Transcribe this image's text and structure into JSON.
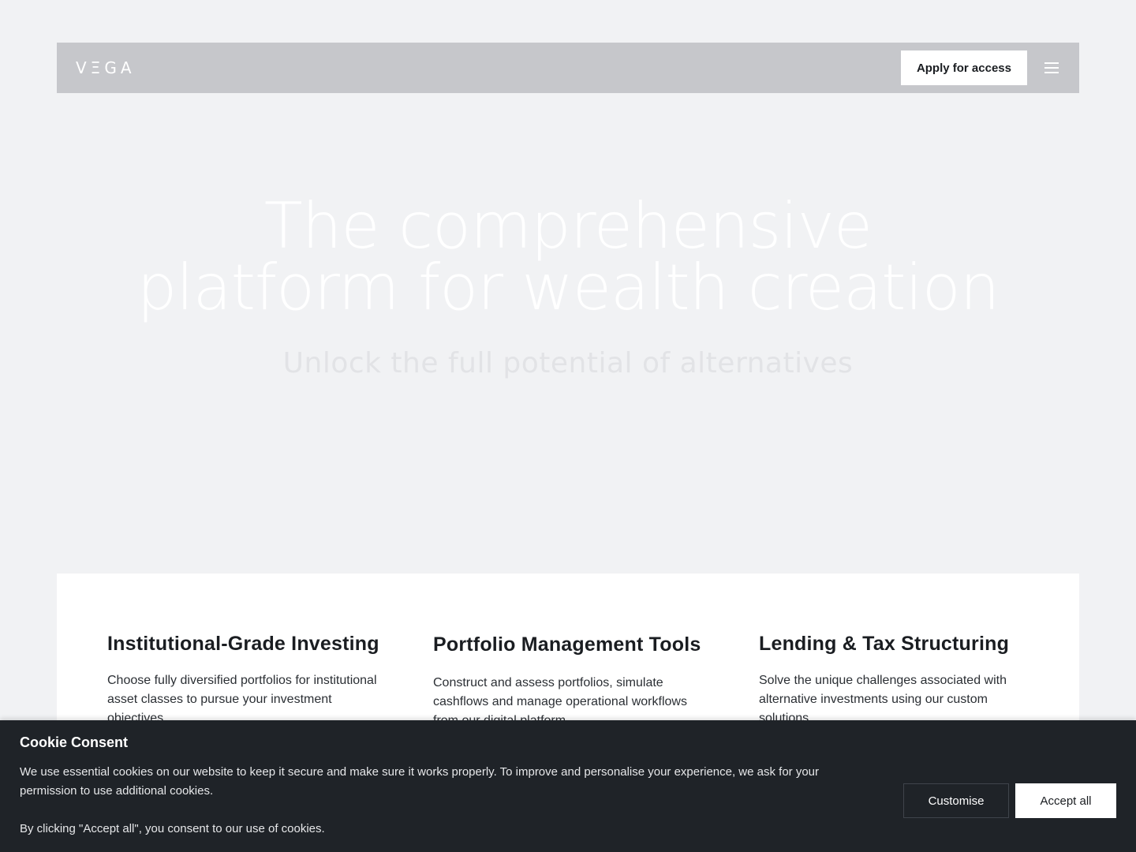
{
  "header": {
    "logo": "VΞGA",
    "apply_label": "Apply for access",
    "menu_icon": "hamburger-menu-icon"
  },
  "hero": {
    "title_line1": "The comprehensive",
    "title_line2": "platform for wealth creation",
    "subtitle": "Unlock the full potential of alternatives"
  },
  "features": [
    {
      "title": "Institutional-Grade Investing",
      "description": "Choose fully diversified portfolios for institutional asset classes to pursue your investment objectives"
    },
    {
      "title": "Portfolio Management Tools",
      "description": "Construct and assess portfolios, simulate cashflows and manage operational workflows from our digital platform"
    },
    {
      "title": "Lending & Tax Structuring",
      "description": "Solve the unique challenges associated with alternative investments using our custom solutions"
    }
  ],
  "cookie": {
    "title": "Cookie Consent",
    "text": "We use essential cookies on our website to keep it secure and make sure it works properly. To improve and personalise your experience, we ask for your permission to use additional cookies.",
    "text2": "By clicking \"Accept all\", you consent to our use of cookies.",
    "customise_label": "Customise",
    "accept_label": "Accept all"
  },
  "colors": {
    "page_bg": "#f1f2f4",
    "navbar_bg": "#c6c7cb",
    "cookie_bg": "#1f2328",
    "text_dark": "#1a1d21"
  }
}
